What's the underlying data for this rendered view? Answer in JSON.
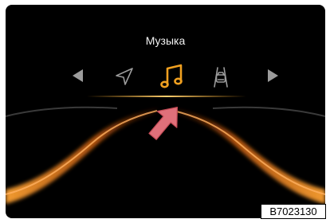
{
  "screen": {
    "title": "Музыка",
    "menu_items": [
      {
        "icon": "navigation-arrow-icon",
        "selected": false
      },
      {
        "icon": "music-note-icon",
        "selected": true
      },
      {
        "icon": "lane-assist-icon",
        "selected": false
      }
    ],
    "nav_prev_icon": "chevron-left-icon",
    "nav_next_icon": "chevron-right-icon",
    "colors": {
      "background": "#000000",
      "accent": "#f0a020",
      "inactive_icon": "#9c9c9c",
      "pointer": "#e0707a"
    }
  },
  "figure_code": "B7023130"
}
